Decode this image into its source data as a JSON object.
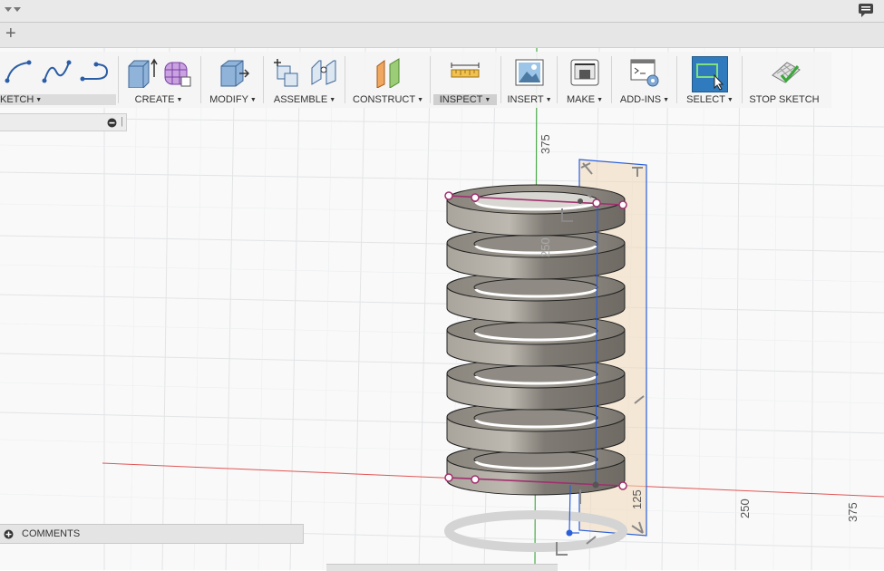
{
  "titlebar": {
    "dropdown_icon": "caret-down-icon",
    "comment_icon": "comment-icon"
  },
  "tabbar": {
    "new_tab_symbol": "+"
  },
  "toolbar": {
    "sketch": {
      "label": "KETCH",
      "icons": [
        "arc-icon",
        "spline-icon",
        "conic-curve-icon"
      ]
    },
    "create": {
      "label": "CREATE",
      "icons": [
        "extrude-icon",
        "form-icon"
      ]
    },
    "modify": {
      "label": "MODIFY",
      "icons": [
        "press-pull-icon"
      ]
    },
    "assemble": {
      "label": "ASSEMBLE",
      "icons": [
        "new-component-icon",
        "joint-icon"
      ]
    },
    "construct": {
      "label": "CONSTRUCT",
      "icons": [
        "offset-plane-icon"
      ]
    },
    "inspect": {
      "label": "INSPECT",
      "icons": [
        "measure-icon"
      ],
      "active": true
    },
    "insert": {
      "label": "INSERT",
      "icons": [
        "insert-image-icon"
      ]
    },
    "make": {
      "label": "MAKE",
      "icons": [
        "3d-print-icon"
      ]
    },
    "addins": {
      "label": "ADD-INS",
      "icons": [
        "scripts-icon"
      ]
    },
    "select": {
      "label": "SELECT",
      "icons": [
        "select-window-icon"
      ]
    },
    "stop_sketch": {
      "label": "STOP SKETCH",
      "icons": [
        "stop-sketch-icon"
      ]
    }
  },
  "browser": {
    "collapse_icon": "minus-circle-icon",
    "pin_glyph": "|"
  },
  "comments": {
    "label": "COMMENTS",
    "icon": "plus-circle-icon"
  },
  "viewport": {
    "axis_labels": {
      "y_top": "375",
      "y_mid": "250",
      "x_125": "125",
      "x_250": "250",
      "x_375": "375"
    },
    "colors": {
      "x_axis": "#e05555",
      "y_axis": "#4caa4c",
      "sketch_profile": "#a0306e",
      "selection": "#2b5fd9",
      "plane": "#f1d8b8",
      "coil": "#8c8982"
    }
  }
}
